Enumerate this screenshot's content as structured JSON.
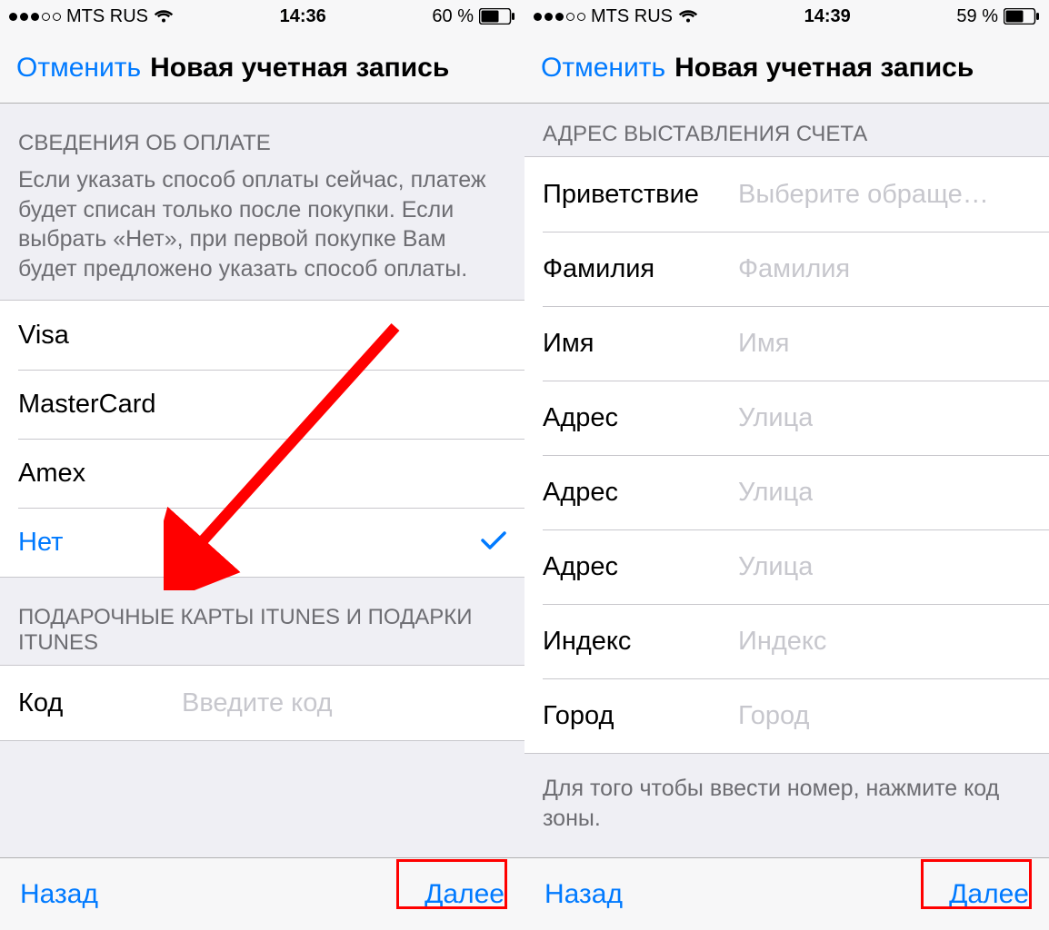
{
  "left": {
    "status": {
      "carrier": "MTS RUS",
      "time": "14:36",
      "battery": "60 %"
    },
    "nav": {
      "cancel": "Отменить",
      "title": "Новая учетная запись"
    },
    "payment": {
      "header": "СВЕДЕНИЯ ОБ ОПЛАТЕ",
      "description": "Если указать способ оплаты сейчас, платеж будет списан только после покупки. Если выбрать «Нет», при первой покупке Вам будет предложено указать способ оплаты.",
      "options": {
        "visa": "Visa",
        "mastercard": "MasterCard",
        "amex": "Amex",
        "none": "Нет"
      }
    },
    "gifts": {
      "header": "ПОДАРОЧНЫЕ КАРТЫ ITUNES И ПОДАРКИ ITUNES",
      "code_label": "Код",
      "code_placeholder": "Введите код"
    },
    "toolbar": {
      "back": "Назад",
      "next": "Далее"
    }
  },
  "right": {
    "status": {
      "carrier": "MTS RUS",
      "time": "14:39",
      "battery": "59 %"
    },
    "nav": {
      "cancel": "Отменить",
      "title": "Новая учетная запись"
    },
    "billing": {
      "header": "АДРЕС ВЫСТАВЛЕНИЯ СЧЕТА",
      "fields": {
        "salutation": {
          "label": "Приветствие",
          "placeholder": "Выберите обраще…"
        },
        "last_name": {
          "label": "Фамилия",
          "placeholder": "Фамилия"
        },
        "first_name": {
          "label": "Имя",
          "placeholder": "Имя"
        },
        "address1": {
          "label": "Адрес",
          "placeholder": "Улица"
        },
        "address2": {
          "label": "Адрес",
          "placeholder": "Улица"
        },
        "address3": {
          "label": "Адрес",
          "placeholder": "Улица"
        },
        "postcode": {
          "label": "Индекс",
          "placeholder": "Индекс"
        },
        "city": {
          "label": "Город",
          "placeholder": "Город"
        }
      },
      "footer": "Для того чтобы ввести номер, нажмите код зоны."
    },
    "toolbar": {
      "back": "Назад",
      "next": "Далее"
    }
  }
}
